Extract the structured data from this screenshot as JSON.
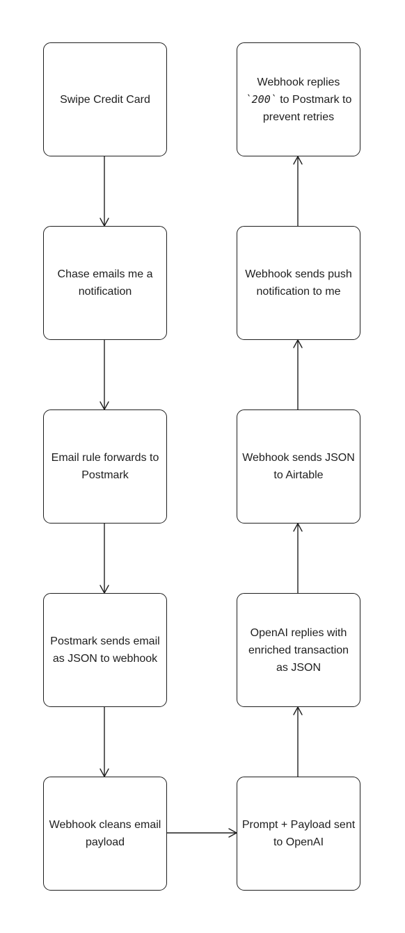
{
  "diagram": {
    "type": "flowchart",
    "nodes": [
      {
        "id": "n1",
        "label": "Swipe Credit Card"
      },
      {
        "id": "n2",
        "label": "Chase emails me a notification"
      },
      {
        "id": "n3",
        "label": "Email rule forwards to Postmark"
      },
      {
        "id": "n4",
        "label": "Postmark sends email as JSON to webhook"
      },
      {
        "id": "n5",
        "label": "Webhook cleans email payload"
      },
      {
        "id": "n6",
        "label": "Prompt + Payload sent to OpenAI"
      },
      {
        "id": "n7",
        "label": "OpenAI replies with enriched transaction as JSON"
      },
      {
        "id": "n8",
        "label": "Webhook sends JSON to Airtable"
      },
      {
        "id": "n9",
        "label": "Webhook sends push notification to me"
      },
      {
        "id": "n10",
        "label": "Webhook replies `200` to Postmark to prevent retries"
      }
    ],
    "edges": [
      {
        "from": "n1",
        "to": "n2"
      },
      {
        "from": "n2",
        "to": "n3"
      },
      {
        "from": "n3",
        "to": "n4"
      },
      {
        "from": "n4",
        "to": "n5"
      },
      {
        "from": "n5",
        "to": "n6"
      },
      {
        "from": "n6",
        "to": "n7"
      },
      {
        "from": "n7",
        "to": "n8"
      },
      {
        "from": "n8",
        "to": "n9"
      },
      {
        "from": "n9",
        "to": "n10"
      }
    ],
    "code_snippet": "200"
  }
}
